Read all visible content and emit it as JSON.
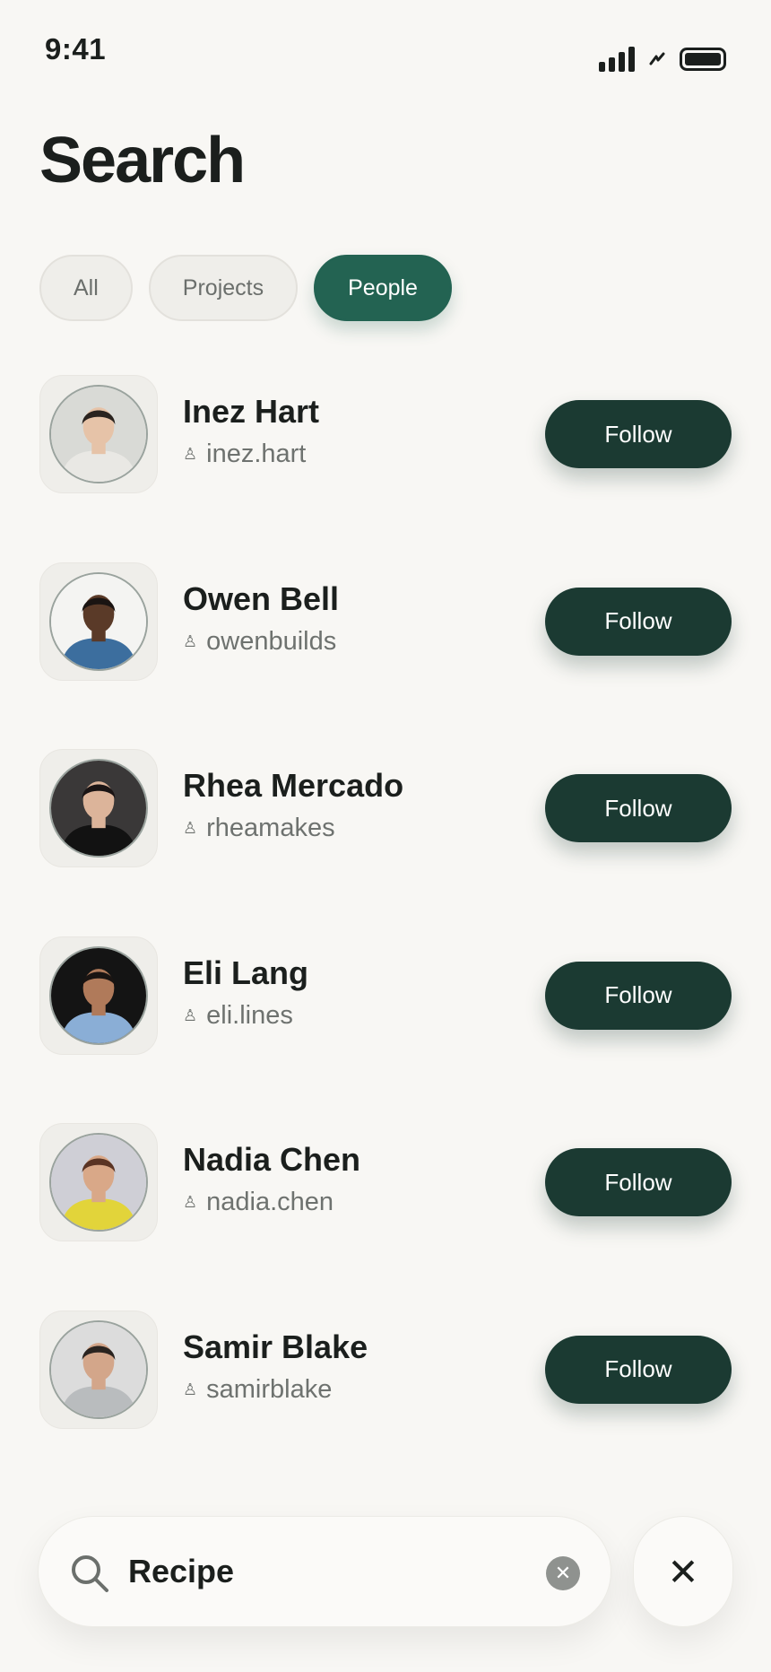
{
  "status_bar": {
    "time": "9:41"
  },
  "page": {
    "title": "Search"
  },
  "filters": [
    {
      "label": "All",
      "active": false
    },
    {
      "label": "Projects",
      "active": false
    },
    {
      "label": "People",
      "active": true
    }
  ],
  "results": [
    {
      "name": "Inez Hart",
      "handle": "inez.hart",
      "follow_label": "Follow",
      "avatar": {
        "bg": "#d9dad6",
        "skin": "#e6c3a8",
        "hair": "#2a231f",
        "shirt": "#e9e8e4"
      }
    },
    {
      "name": "Owen Bell",
      "handle": "owenbuilds",
      "follow_label": "Follow",
      "avatar": {
        "bg": "#f4f4f2",
        "skin": "#5a3a28",
        "hair": "#1a1412",
        "shirt": "#3c6e9e"
      }
    },
    {
      "name": "Rhea Mercado",
      "handle": "rheamakes",
      "follow_label": "Follow",
      "avatar": {
        "bg": "#3a3838",
        "skin": "#dcb49a",
        "hair": "#1a1414",
        "shirt": "#121212"
      }
    },
    {
      "name": "Eli Lang",
      "handle": "eli.lines",
      "follow_label": "Follow",
      "avatar": {
        "bg": "#141414",
        "skin": "#b07a5a",
        "hair": "#1a1412",
        "shirt": "#8aaed6"
      }
    },
    {
      "name": "Nadia Chen",
      "handle": "nadia.chen",
      "follow_label": "Follow",
      "avatar": {
        "bg": "#cfcfd6",
        "skin": "#d9a888",
        "hair": "#5a3424",
        "shirt": "#e2d43a"
      }
    },
    {
      "name": "Samir Blake",
      "handle": "samirblake",
      "follow_label": "Follow",
      "avatar": {
        "bg": "#dcdcdc",
        "skin": "#d3a68a",
        "hair": "#2a2420",
        "shirt": "#b9bcbe"
      }
    }
  ],
  "search": {
    "value": "Recipe",
    "clear_icon": "clear-icon",
    "close_icon": "close-icon"
  },
  "colors": {
    "accent": "#236352",
    "follow_bg": "#1b3a32",
    "background": "#f8f7f4"
  }
}
